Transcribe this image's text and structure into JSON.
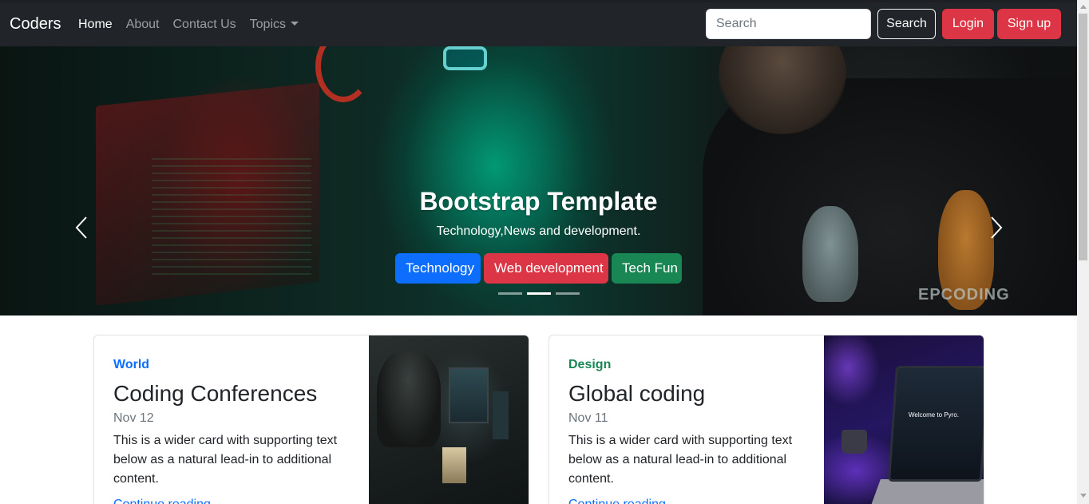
{
  "navbar": {
    "brand": "Coders",
    "links": [
      {
        "label": "Home",
        "active": true
      },
      {
        "label": "About",
        "active": false
      },
      {
        "label": "Contact Us",
        "active": false
      },
      {
        "label": "Topics",
        "active": false,
        "dropdown": true
      }
    ],
    "search_placeholder": "Search",
    "search_button": "Search",
    "login_button": "Login",
    "signup_button": "Sign up"
  },
  "hero": {
    "title": "Bootstrap Template",
    "subtitle": "Technology,News and development.",
    "buttons": [
      {
        "label": "Technology",
        "color": "#0d6efd"
      },
      {
        "label": "Web development",
        "color": "#dc3545"
      },
      {
        "label": "Tech Fun",
        "color": "#198754"
      }
    ],
    "indicators": 3,
    "active_indicator": 2,
    "shirt_text": "EPCODING"
  },
  "cards": [
    {
      "category": "World",
      "title": "Coding Conferences",
      "date": "Nov 12",
      "text": "This is a wider card with supporting text below as a natural lead-in to additional content.",
      "link": "Continue reading"
    },
    {
      "category": "Design",
      "title": "Global coding",
      "date": "Nov 11",
      "text": "This is a wider card with supporting text below as a natural lead-in to additional content.",
      "link": "Continue reading",
      "image_text": "Welcome to Pyro."
    }
  ],
  "colors": {
    "navbar_bg": "#212529",
    "primary": "#0d6efd",
    "danger": "#dc3545",
    "success": "#198754"
  },
  "icons": {
    "carousel_prev": "chevron-left-icon",
    "carousel_next": "chevron-right-icon",
    "topics_caret": "caret-down-icon"
  }
}
